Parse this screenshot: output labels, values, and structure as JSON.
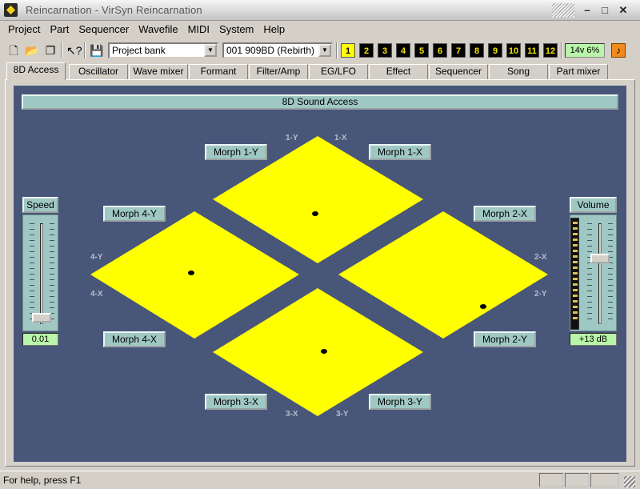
{
  "window": {
    "title": "Reincarnation - VirSyn  Reincarnation"
  },
  "menu": [
    "Project",
    "Part",
    "Sequencer",
    "Wavefile",
    "MIDI",
    "System",
    "Help"
  ],
  "toolbar": {
    "bank_select": "Project bank",
    "patch_select": "001 909BD (Rebirth)",
    "parts": [
      "1",
      "2",
      "3",
      "4",
      "5",
      "6",
      "7",
      "8",
      "9",
      "10",
      "11",
      "12"
    ],
    "active_part": "1",
    "voice_status": "14v  6%",
    "icons": [
      "new-file-icon",
      "open-folder-icon",
      "copy-pages-icon",
      "help-pointer-icon",
      "save-disk-icon",
      "midi-activity-icon"
    ]
  },
  "tabs": [
    "8D Access",
    "Oscillator",
    "Wave mixer",
    "Formant",
    "Filter/Amp",
    "EG/LFO",
    "Effect",
    "Sequencer",
    "Song",
    "Part mixer"
  ],
  "active_tab": "8D Access",
  "panel": {
    "header": "8D Sound Access",
    "morph_buttons": {
      "m1y": "Morph 1-Y",
      "m1x": "Morph 1-X",
      "m2x": "Morph 2-X",
      "m2y": "Morph 2-Y",
      "m3x": "Morph 3-X",
      "m3y": "Morph 3-Y",
      "m4y": "Morph 4-Y",
      "m4x": "Morph 4-X"
    },
    "axis_labels": {
      "a1y": "1-Y",
      "a1x": "1-X",
      "a2x": "2-X",
      "a2y": "2-Y",
      "a3x": "3-X",
      "a3y": "3-Y",
      "a4y": "4-Y",
      "a4x": "4-X"
    },
    "diamond_color": "#ffff00",
    "background_color": "#485679",
    "speed": {
      "label": "Speed",
      "value": "0.01"
    },
    "volume": {
      "label": "Volume",
      "value": "+13 dB"
    }
  },
  "status": {
    "help": "For help, press F1"
  }
}
